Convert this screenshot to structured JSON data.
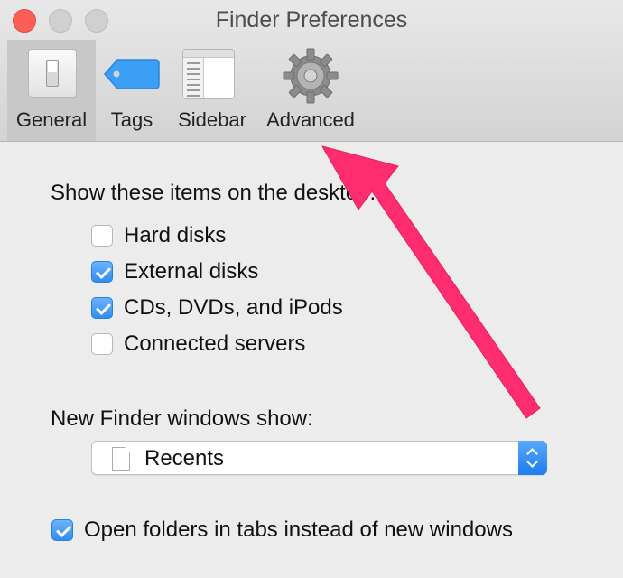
{
  "window": {
    "title": "Finder Preferences"
  },
  "toolbar": {
    "tabs": [
      {
        "label": "General",
        "icon": "switch-icon",
        "selected": true
      },
      {
        "label": "Tags",
        "icon": "tag-icon",
        "selected": false
      },
      {
        "label": "Sidebar",
        "icon": "sidebar-icon",
        "selected": false
      },
      {
        "label": "Advanced",
        "icon": "gear-icon",
        "selected": false
      }
    ]
  },
  "desktop_section": {
    "heading": "Show these items on the desktop:",
    "items": [
      {
        "label": "Hard disks",
        "checked": false
      },
      {
        "label": "External disks",
        "checked": true
      },
      {
        "label": "CDs, DVDs, and iPods",
        "checked": true
      },
      {
        "label": "Connected servers",
        "checked": false
      }
    ]
  },
  "new_window_section": {
    "heading": "New Finder windows show:",
    "selected": "Recents"
  },
  "tabs_option": {
    "label": "Open folders in tabs instead of new windows",
    "checked": true
  },
  "colors": {
    "annotation_arrow": "#ff2d6f",
    "checkbox_blue": "#2f8ef0",
    "close_button": "#fc5f57"
  }
}
